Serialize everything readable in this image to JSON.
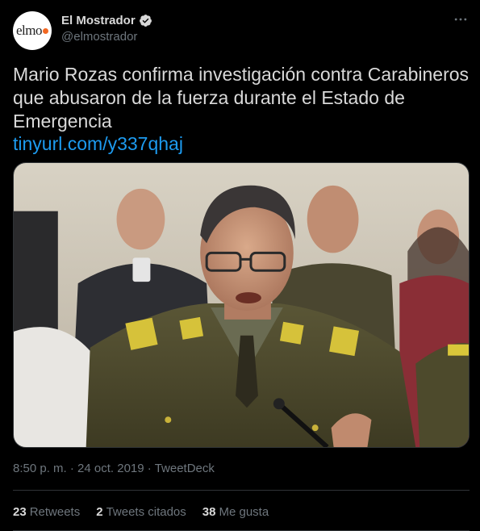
{
  "account": {
    "display_name": "El Mostrador",
    "handle": "@elmostrador",
    "avatar_text": "elmo",
    "avatar_dot_color": "#f26722",
    "verified": true
  },
  "tweet": {
    "text": "Mario Rozas confirma investigación contra Carabineros que abusaron de la fuerza durante el Estado de Emergencia",
    "link": "tinyurl.com/y337qhaj",
    "more_icon": "more-icon",
    "media_icon": "photo"
  },
  "meta": {
    "time": "8:50 p. m.",
    "separator": "·",
    "date": "24 oct. 2019",
    "source": "TweetDeck"
  },
  "stats": {
    "retweets_count": "23",
    "retweets_label": "Retweets",
    "quotes_count": "2",
    "quotes_label": "Tweets citados",
    "likes_count": "38",
    "likes_label": "Me gusta"
  },
  "colors": {
    "background": "#000000",
    "text": "#d9d9d9",
    "muted": "#6e767d",
    "link": "#1d9bf0",
    "divider": "#2f3336"
  }
}
